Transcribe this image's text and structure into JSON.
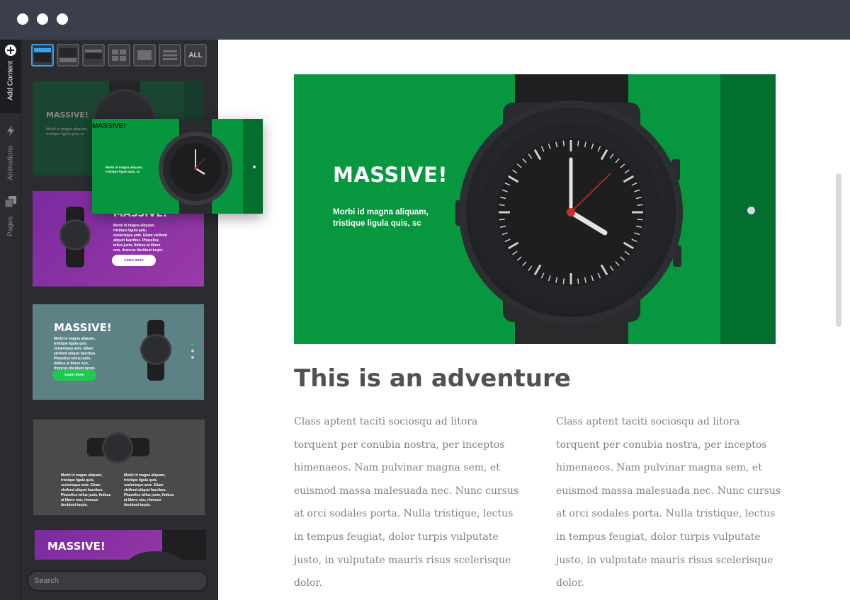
{
  "sidebar_tabs": [
    {
      "label": "Add Content",
      "icon": "plus-circle-icon",
      "active": true
    },
    {
      "label": "Animations",
      "icon": "lightning-icon",
      "active": false
    },
    {
      "label": "Pages",
      "icon": "pages-icon",
      "active": false
    }
  ],
  "filters": {
    "all_label": "ALL",
    "buttons": [
      "hero-layout-icon",
      "split-layout-icon",
      "banner-layout-icon",
      "grid-layout-icon",
      "block-layout-icon",
      "list-layout-icon"
    ]
  },
  "thumbnails": [
    {
      "title": "MASSIVE!",
      "body": "Morbi id magna aliquam, tristique ligula quis, sc",
      "bg": "#0b5a33"
    },
    {
      "title": "MASSIVE!",
      "body": "Morbi id magna aliquam, tristique ligula quis, scelerisque ante. Etiam eleifend aliquet faucibus. Phasellus tellus justo, finibus at libero non, rhoncus tincidunt turpis.",
      "button": "Learn more",
      "bg": "#7a2c9c"
    },
    {
      "title": "MASSIVE!",
      "body": "Morbi id magna aliquam, tristique ligula quis, scelerisque ante. Etiam eleifend aliquet faucibus. Phasellus tellus justo, finibus at libero non, rhoncus tincidunt turpis.",
      "button": "Learn more",
      "bg": "#5d8286"
    },
    {
      "body_left": "Morbi id magna aliquam, tristique ligula quis, scelerisque ante. Etiam eleifend aliquet faucibus. Phasellus tellus justo, finibus at libero non, rhoncus tincidunt turpis.",
      "body_right": "Morbi id magna aliquam, tristique ligula quis, scelerisque ante. Etiam eleifend aliquet faucibus. Phasellus tellus justo, finibus at libero non, rhoncus tincidunt turpis.",
      "bg": "#4a4a4a"
    },
    {
      "title": "MASSIVE!",
      "bg": "#7a2c9c"
    }
  ],
  "drag_preview": {
    "title": "MASSIVE!",
    "body": "Morbi id magna aliquam, tristique ligula quis, sc"
  },
  "search": {
    "placeholder": "Search"
  },
  "hero": {
    "title": "MASSIVE!",
    "body": "Morbi id magna aliquam, tristique ligula quis,  sc",
    "bg": "#06973f",
    "side_bg": "#036f2e"
  },
  "content": {
    "heading": "This is an adventure",
    "paragraph_1": "Class aptent taciti sociosqu ad litora torquent per conubia nostra, per inceptos himenaeos. Nam pulvinar magna sem, et euismod massa malesuada nec. Nunc cursus at orci sodales porta. Nulla tristique, lectus in tempus feugiat, dolor turpis vulputate justo, in vulputate mauris risus scelerisque dolor.",
    "paragraph_2": "Class aptent taciti sociosqu ad litora torquent per conubia nostra, per inceptos himenaeos. Nam pulvinar magna sem, et euismod massa malesuada nec. Nunc cursus at orci sodales porta. Nulla tristique, lectus in tempus feugiat, dolor turpis vulputate justo, in vulputate mauris risus scelerisque dolor."
  }
}
